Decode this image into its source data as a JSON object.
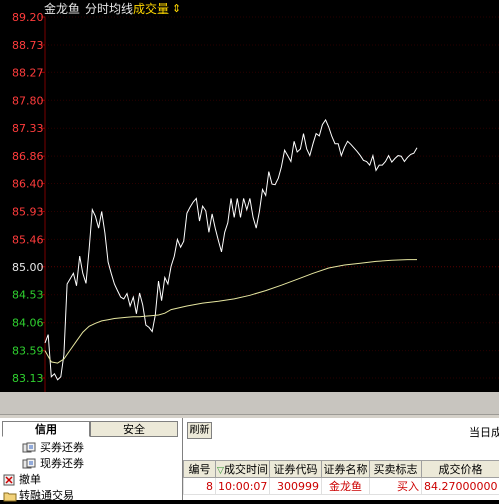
{
  "chart_header": {
    "stock_name": "金龙鱼",
    "period": "分时",
    "avg_label": "均线",
    "volume_label": "成交量",
    "arrow_glyph": "⇕"
  },
  "colors": {
    "background": "#000000",
    "price_line": "#ffffff",
    "avg_line": "#e6e6a0",
    "axis_label_red": "#ff3c3c",
    "axis_label_green": "#2fd12f",
    "axis_label_base": "#e8e8e8",
    "grid": "#2a0000"
  },
  "chart_data": {
    "type": "line",
    "title": "",
    "xlabel": "",
    "ylabel": "",
    "ylim": [
      83.13,
      89.2
    ],
    "y_ticks": [
      "89.20",
      "88.73",
      "88.27",
      "87.80",
      "87.33",
      "86.86",
      "86.40",
      "85.93",
      "85.46",
      "85.00",
      "84.53",
      "84.06",
      "83.59",
      "83.13"
    ],
    "base_price": 85.0,
    "series": [
      {
        "x": [
          0,
          1,
          2,
          3,
          4,
          5,
          6,
          7,
          8,
          9,
          10,
          11,
          12,
          13,
          14,
          15,
          16,
          17,
          18,
          19,
          20,
          21,
          22,
          23,
          24,
          25,
          26,
          27,
          28,
          29,
          30,
          31,
          32,
          33,
          34,
          35,
          36,
          37,
          38,
          39,
          40,
          41,
          42,
          43,
          44,
          45,
          46,
          47,
          48,
          49,
          50,
          51,
          52,
          53,
          54,
          55,
          56,
          57,
          58,
          59,
          60,
          61,
          62,
          63,
          64,
          65,
          66,
          67,
          68,
          69,
          70,
          71,
          72,
          73,
          74,
          75,
          76,
          77,
          78,
          79,
          80,
          81,
          82,
          83,
          84,
          85,
          86,
          87,
          88,
          89,
          90,
          91,
          92,
          93,
          94,
          95,
          96,
          97,
          98,
          99,
          100,
          101,
          102,
          103,
          104,
          105,
          106,
          107,
          108,
          109,
          110,
          111,
          112,
          113,
          114,
          115,
          116,
          117,
          118
        ],
        "values": [
          83.72,
          83.86,
          83.15,
          83.2,
          83.1,
          83.15,
          83.52,
          84.71,
          84.8,
          84.89,
          84.68,
          85.18,
          84.89,
          84.72,
          85.29,
          85.96,
          85.85,
          85.65,
          85.93,
          85.57,
          85.08,
          84.89,
          84.71,
          84.6,
          84.49,
          84.46,
          84.55,
          84.34,
          84.49,
          84.21,
          84.56,
          84.36,
          84.02,
          83.98,
          83.91,
          84.19,
          84.76,
          84.43,
          84.82,
          84.71,
          85.01,
          85.18,
          85.46,
          85.33,
          85.43,
          85.9,
          86.0,
          86.09,
          86.15,
          85.77,
          86.02,
          85.94,
          85.58,
          85.89,
          85.65,
          85.44,
          85.25,
          85.58,
          85.74,
          86.15,
          85.83,
          86.15,
          85.83,
          86.15,
          85.96,
          86.15,
          85.83,
          85.65,
          85.93,
          86.3,
          86.2,
          86.6,
          86.39,
          86.38,
          86.49,
          86.68,
          86.96,
          86.87,
          86.77,
          87.11,
          86.93,
          86.98,
          87.24,
          86.98,
          86.87,
          87.07,
          87.24,
          87.2,
          87.39,
          87.47,
          87.35,
          87.19,
          87.07,
          87.07,
          86.87,
          87.01,
          87.11,
          87.06,
          87.0,
          86.94,
          86.87,
          86.79,
          86.77,
          86.71,
          86.87,
          86.62,
          86.71,
          86.71,
          86.77,
          86.87,
          86.76,
          86.82,
          86.87,
          86.86,
          86.77,
          86.84,
          86.89,
          86.91,
          87.0
        ]
      },
      {
        "x": [
          0,
          2,
          4,
          6,
          8,
          10,
          12,
          14,
          16,
          18,
          20,
          22,
          24,
          26,
          28,
          30,
          32,
          34,
          36,
          38,
          40,
          45,
          50,
          55,
          60,
          65,
          70,
          75,
          80,
          85,
          90,
          95,
          100,
          105,
          110,
          115,
          118
        ],
        "values": [
          83.59,
          83.4,
          83.38,
          83.45,
          83.6,
          83.75,
          83.9,
          84.0,
          84.05,
          84.09,
          84.11,
          84.13,
          84.14,
          84.15,
          84.16,
          84.16,
          84.17,
          84.18,
          84.19,
          84.22,
          84.28,
          84.34,
          84.39,
          84.42,
          84.46,
          84.52,
          84.6,
          84.69,
          84.79,
          84.89,
          84.98,
          85.03,
          85.06,
          85.09,
          85.11,
          85.12,
          85.12
        ]
      }
    ],
    "grid": true
  },
  "left_panel": {
    "tabs": [
      {
        "label": "信用",
        "active": true
      },
      {
        "label": "安全",
        "active": false
      }
    ],
    "tree": [
      {
        "label": "买券还券",
        "level": 1
      },
      {
        "label": "现券还券",
        "level": 1
      },
      {
        "label": "撤单",
        "level": 0
      },
      {
        "label": "转融通交易",
        "level": 0
      }
    ]
  },
  "right_panel": {
    "refresh_label": "刷新",
    "date_label": "当日成",
    "table": {
      "headers": [
        "编号",
        "成交时间",
        "证券代码",
        "证券名称",
        "买卖标志",
        "成交价格"
      ],
      "rows": [
        [
          "8",
          "10:00:07",
          "300999",
          "金龙鱼",
          "买入",
          "84.27000000"
        ]
      ]
    }
  }
}
